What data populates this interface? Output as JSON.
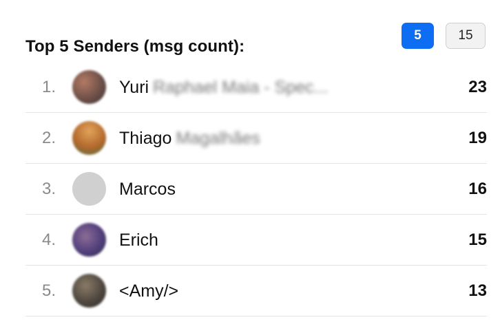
{
  "header": {
    "title": "Top 5 Senders (msg count):",
    "toggles": [
      {
        "label": "5",
        "active": true
      },
      {
        "label": "15",
        "active": false
      }
    ]
  },
  "senders": [
    {
      "rank": "1.",
      "name": "Yuri",
      "name_obscured": "Raphael Maia - Spec...",
      "count": "23",
      "avatar": "yuri-avatar-photo"
    },
    {
      "rank": "2.",
      "name": "Thiago",
      "name_obscured": "Magalhães",
      "count": "19",
      "avatar": "thiago-avatar-photo"
    },
    {
      "rank": "3.",
      "name": "Marcos",
      "name_obscured": "",
      "count": "16",
      "avatar": "placeholder-avatar"
    },
    {
      "rank": "4.",
      "name": "Erich",
      "name_obscured": "",
      "count": "15",
      "avatar": "erich-avatar-photo"
    },
    {
      "rank": "5.",
      "name": "<Amy/>",
      "name_obscured": "",
      "count": "13",
      "avatar": "amy-avatar-photo"
    }
  ],
  "colors": {
    "accent": "#0d6ef4",
    "inactive_toggle_bg": "#f2f2f2",
    "rank_text": "#8a8a8a",
    "divider": "#e3e3e3"
  }
}
